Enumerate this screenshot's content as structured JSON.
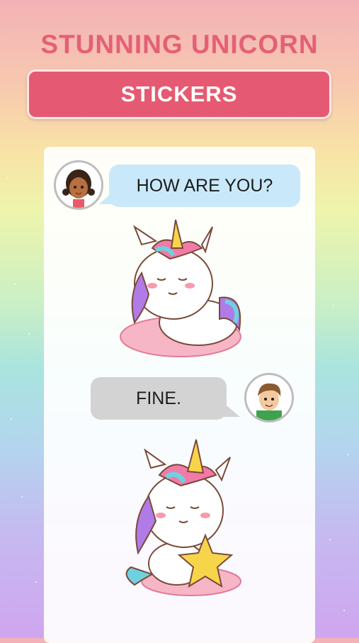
{
  "header": {
    "title": "STUNNING UNICORN",
    "subtitle": "STICKERS"
  },
  "chat": {
    "message_1": "HOW ARE YOU?",
    "message_2": "FINE."
  },
  "colors": {
    "title": "#e46075",
    "banner": "#e55a72",
    "bubble_incoming": "#c9e9fa",
    "bubble_outgoing": "#d3d3d3"
  }
}
